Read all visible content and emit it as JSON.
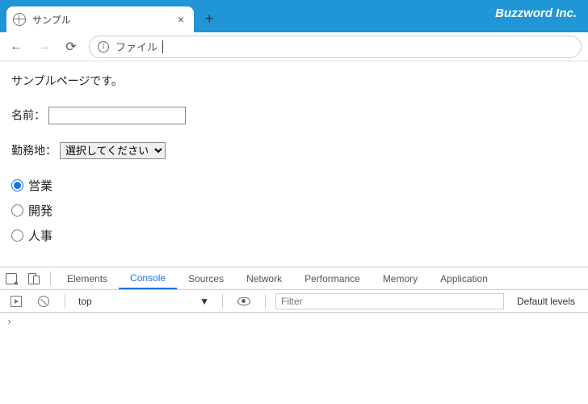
{
  "browser": {
    "tab_title": "サンプル",
    "brand": "Buzzword Inc.",
    "address_label": "ファイル"
  },
  "page": {
    "intro": "サンプルページです。",
    "name_label": "名前：",
    "name_value": "",
    "location_label": "勤務地：",
    "location_selected": "選択してください",
    "radios": [
      "営業",
      "開発",
      "人事"
    ]
  },
  "devtools": {
    "tabs": [
      "Elements",
      "Console",
      "Sources",
      "Network",
      "Performance",
      "Memory",
      "Application"
    ],
    "active_tab": "Console",
    "context": "top",
    "filter_placeholder": "Filter",
    "levels": "Default levels",
    "prompt": "›"
  }
}
